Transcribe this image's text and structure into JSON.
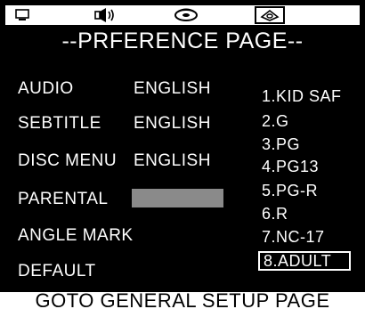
{
  "icons": {
    "monitor": "monitor-icon",
    "speaker": "speaker-icon",
    "disc": "disc-icon",
    "settings": "settings-box-icon"
  },
  "page_title": "--PRFERENCE PAGE--",
  "settings": [
    {
      "label": "AUDIO",
      "value": "ENGLISH"
    },
    {
      "label": "SEBTITLE",
      "value": "ENGLISH"
    },
    {
      "label": "DISC MENU",
      "value": "ENGLISH"
    },
    {
      "label": "PARENTAL",
      "value": ""
    },
    {
      "label": "ANGLE MARK",
      "value": ""
    },
    {
      "label": "DEFAULT",
      "value": ""
    }
  ],
  "parental_options": [
    "1.KID SAF",
    "2.G",
    "3.PG",
    "4.PG13",
    "5.PG-R",
    "6.R",
    "7.NC-17",
    "8.ADULT"
  ],
  "selected_option": "8.ADULT",
  "footer": "GOTO GENERAL SETUP PAGE",
  "colors": {
    "background": "#000000",
    "text": "#ffffff",
    "highlight_box": "#8a8a8a"
  }
}
